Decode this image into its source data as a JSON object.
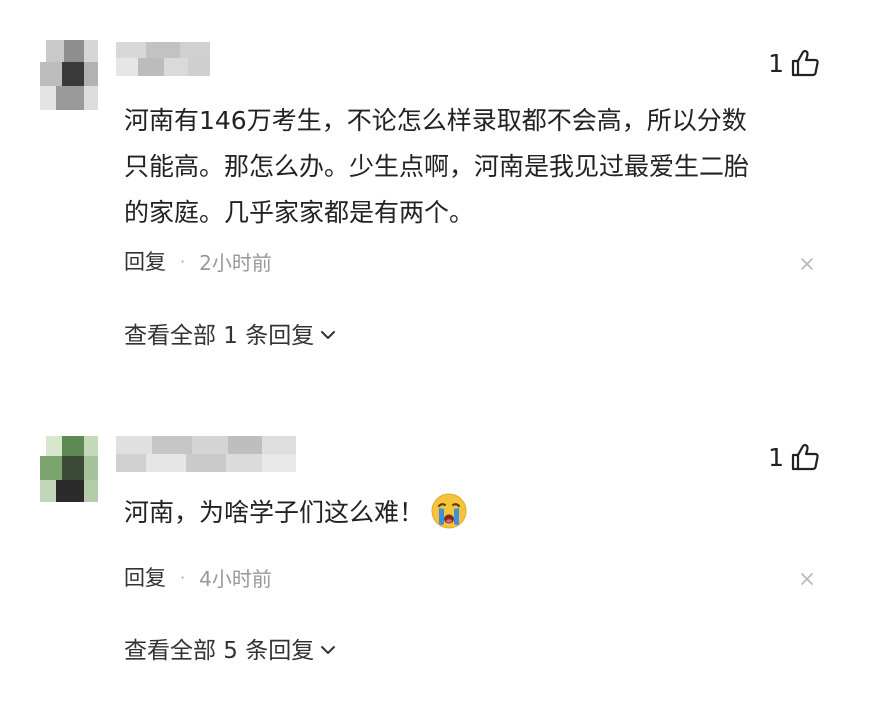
{
  "comments": [
    {
      "likes": "1",
      "text": "河南有146万考生，不论怎么样录取都不会高，所以分数只能高。那怎么办。少生点啊，河南是我见过最爱生二胎的家庭。几乎家家都是有两个。",
      "line1": "河南有146万考生，不论怎么样录取都不会高，所以分数",
      "line2": "只能高。那怎么办。少生点啊，河南是我见过最爱生二胎",
      "line3": "的家庭。几乎家家都是有两个。",
      "reply_label": "回复",
      "separator": "·",
      "time": "2小时前",
      "view_all_label": "查看全部 1 条回复"
    },
    {
      "likes": "1",
      "text": "河南，为啥学子们这么难！",
      "emoji": "crying-face-icon",
      "reply_label": "回复",
      "separator": "·",
      "time": "4小时前",
      "view_all_label": "查看全部 5 条回复"
    }
  ],
  "colors": {
    "text": "#222222",
    "meta": "#999999",
    "emoji_face": "#F6C33C",
    "emoji_tears": "#3E8FE0"
  }
}
